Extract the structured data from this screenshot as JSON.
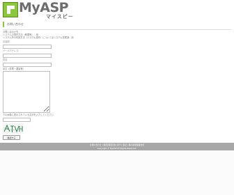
{
  "header": {
    "logo_text": "MyASP",
    "logo_sub": "マイスピー"
  },
  "page": {
    "heading": "お問い合わせ",
    "notes": [
      "お問い合わせ先",
      "システムの操作方法（概要等）：用",
      "システム外の利用方法（システム操作）についてはシステム営業部：用"
    ]
  },
  "form": {
    "name_label": "お名前",
    "email_label": "メールアドレス",
    "subject_label": "件名",
    "message_label": "本文（質問・要望等）",
    "captcha_prompt": "下の画像に表示されている文字を入力してください",
    "captcha_text": "ATVH",
    "confirm_button": "確認する"
  },
  "footer": {
    "links": "お問い合わせ | 特定商取引法に基づく表記 | 個人情報保護方針",
    "copyright": "Copyright © MyASP All Rights Reserved."
  }
}
